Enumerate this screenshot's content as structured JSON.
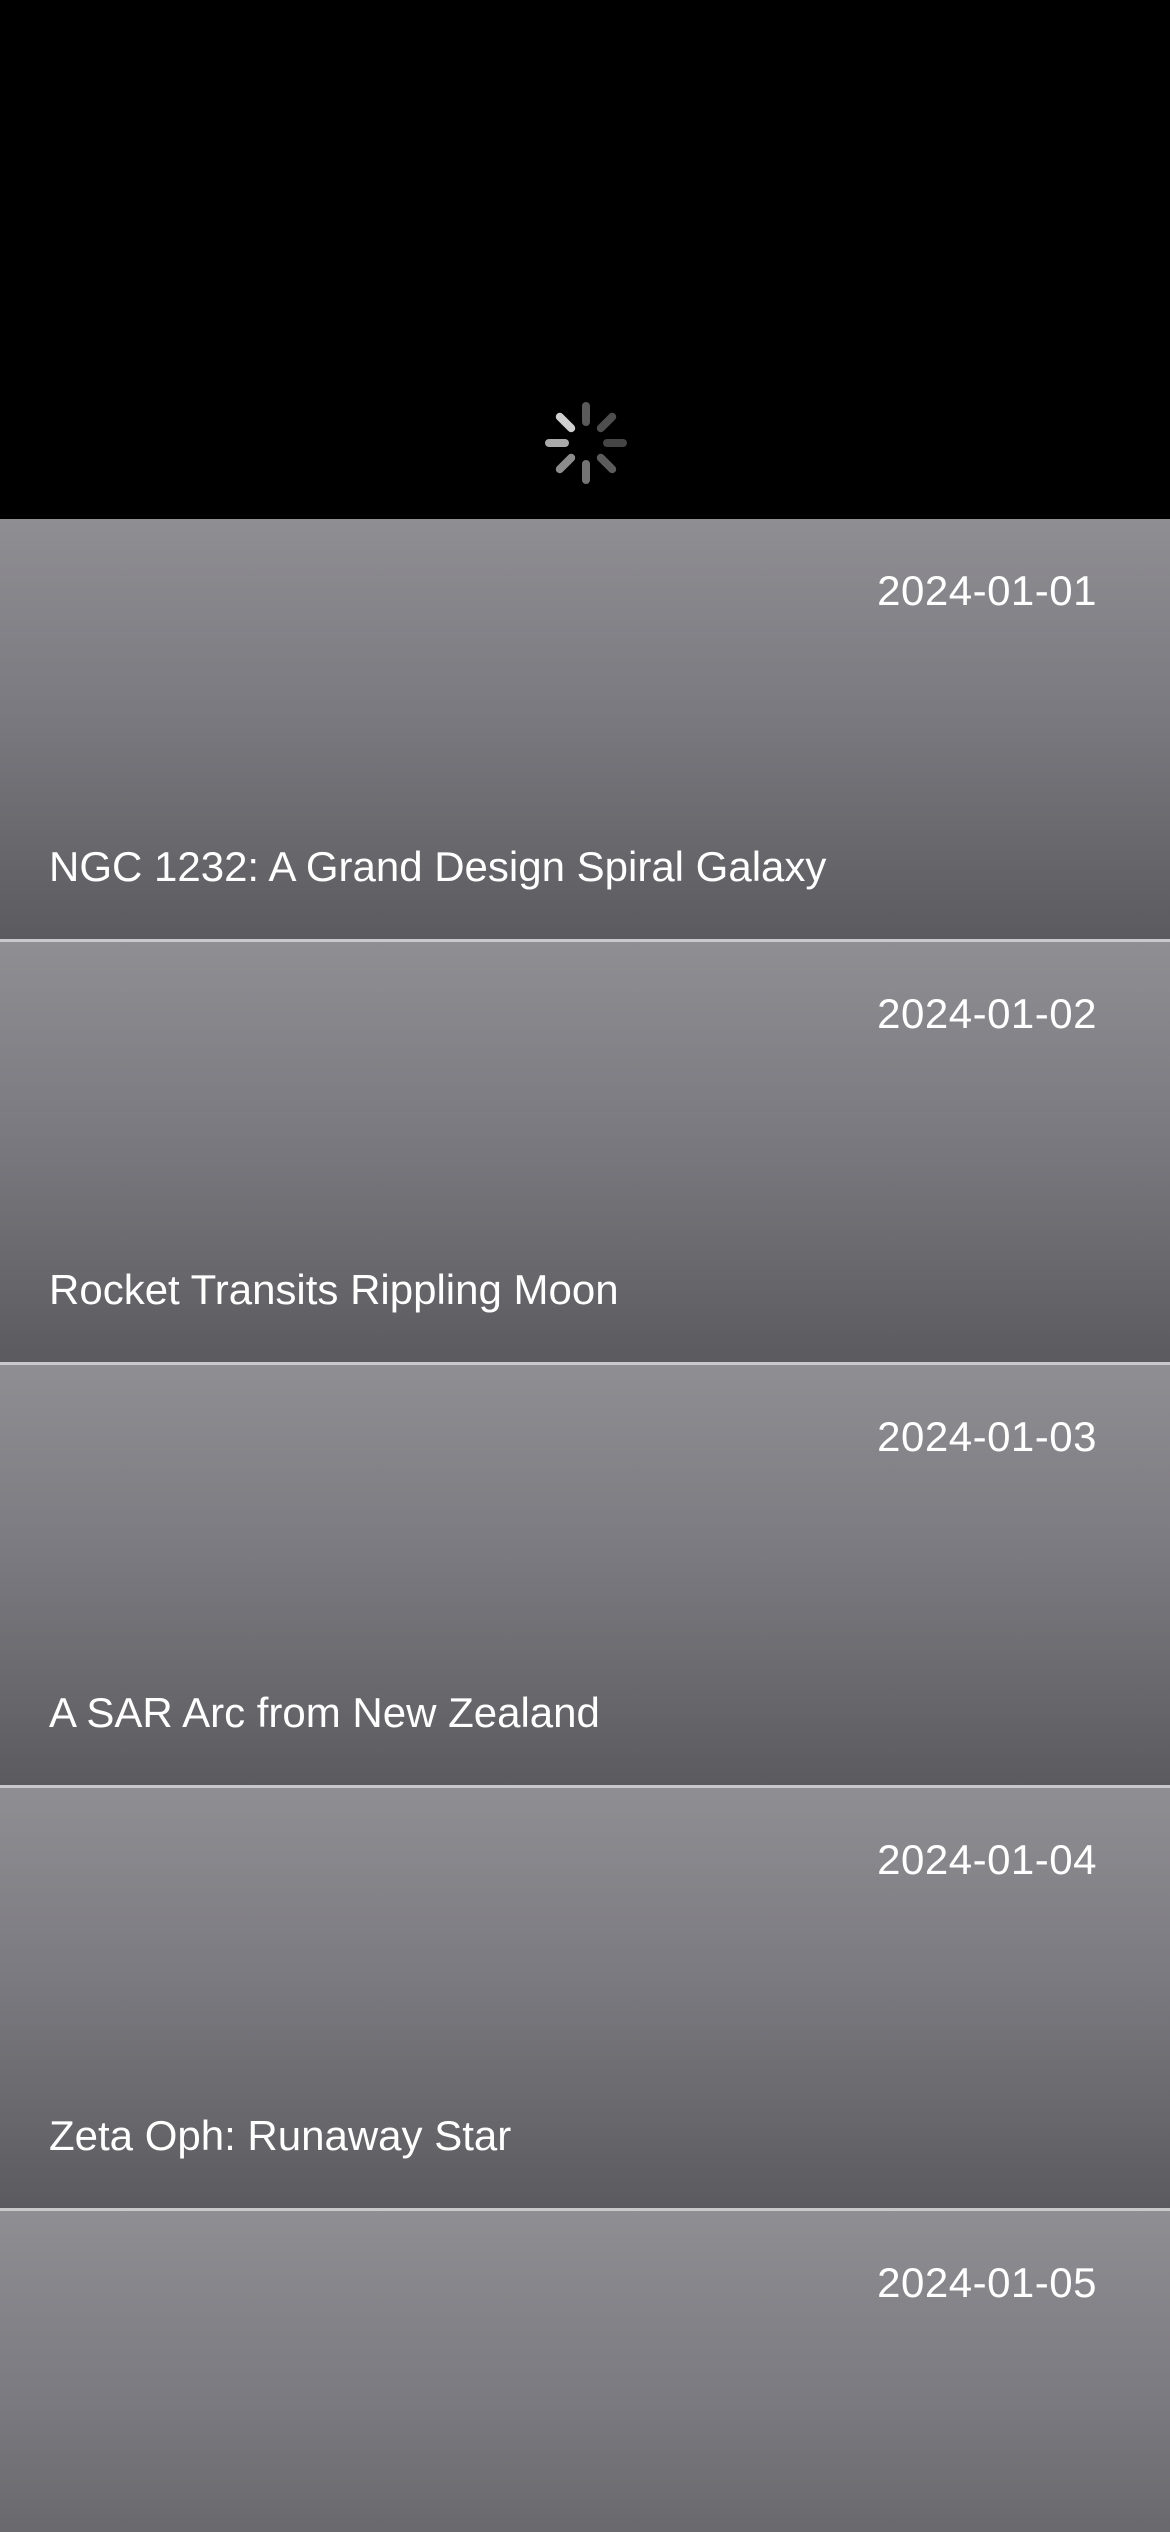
{
  "header": {
    "spinner_icon": "activity-indicator-icon"
  },
  "feed": {
    "items": [
      {
        "date": "2024-01-01",
        "title": "NGC 1232: A Grand Design Spiral Galaxy"
      },
      {
        "date": "2024-01-02",
        "title": "Rocket Transits Rippling Moon"
      },
      {
        "date": "2024-01-03",
        "title": "A SAR Arc from New Zealand"
      },
      {
        "date": "2024-01-04",
        "title": "Zeta Oph: Runaway Star"
      },
      {
        "date": "2024-01-05",
        "title": ""
      }
    ]
  },
  "colors": {
    "background": "#000000",
    "card_top": "#8f8e93",
    "card_bottom": "#5b5b5f",
    "separator": "#c9c9cc",
    "text": "#ffffff"
  }
}
